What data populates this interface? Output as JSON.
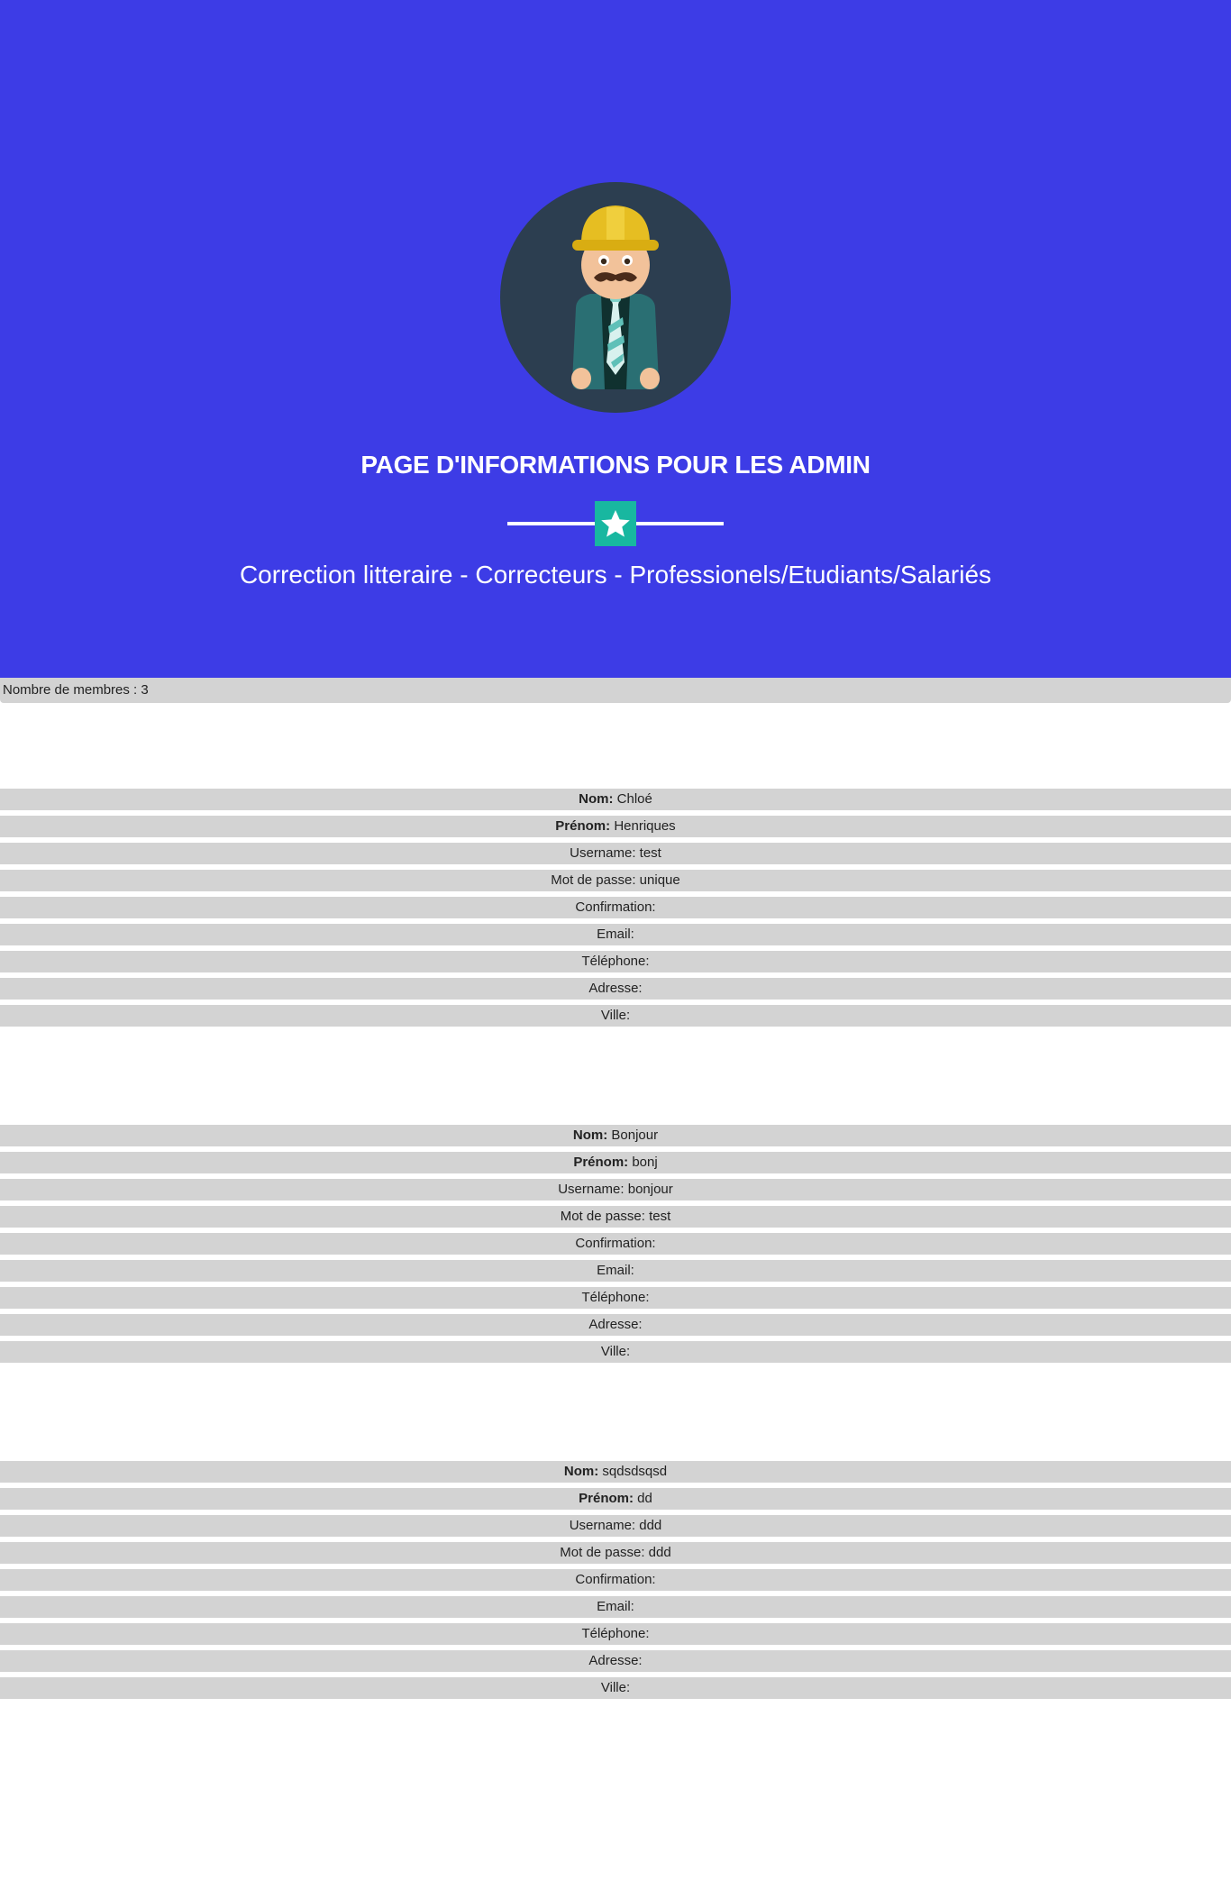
{
  "header": {
    "title": "PAGE D'INFORMATIONS POUR LES ADMIN",
    "subtitle": "Correction litteraire - Correcteurs - Professionels/Etudiants/Salariés",
    "avatar_icon": "worker-avatar-icon",
    "divider_icon": "star-icon"
  },
  "summary": {
    "count_label": "Nombre de membres : 3"
  },
  "labels": {
    "nom": "Nom:",
    "prenom": "Prénom:",
    "username": "Username:",
    "password": "Mot de passe:",
    "confirmation": "Confirmation:",
    "email": "Email:",
    "telephone": "Téléphone:",
    "adresse": "Adresse:",
    "ville": "Ville:"
  },
  "members": [
    {
      "nom": "Chloé",
      "prenom": "Henriques",
      "username": "test",
      "password": "unique",
      "confirmation": "",
      "email": "",
      "telephone": "",
      "adresse": "",
      "ville": ""
    },
    {
      "nom": "Bonjour",
      "prenom": "bonj",
      "username": "bonjour",
      "password": "test",
      "confirmation": "",
      "email": "",
      "telephone": "",
      "adresse": "",
      "ville": ""
    },
    {
      "nom": "sqdsdsqsd",
      "prenom": "dd",
      "username": "ddd",
      "password": "ddd",
      "confirmation": "",
      "email": "",
      "telephone": "",
      "adresse": "",
      "ville": ""
    }
  ],
  "colors": {
    "hero_bg": "#3d3ce6",
    "accent": "#18b7a0",
    "row_bg": "#d3d3d3"
  }
}
